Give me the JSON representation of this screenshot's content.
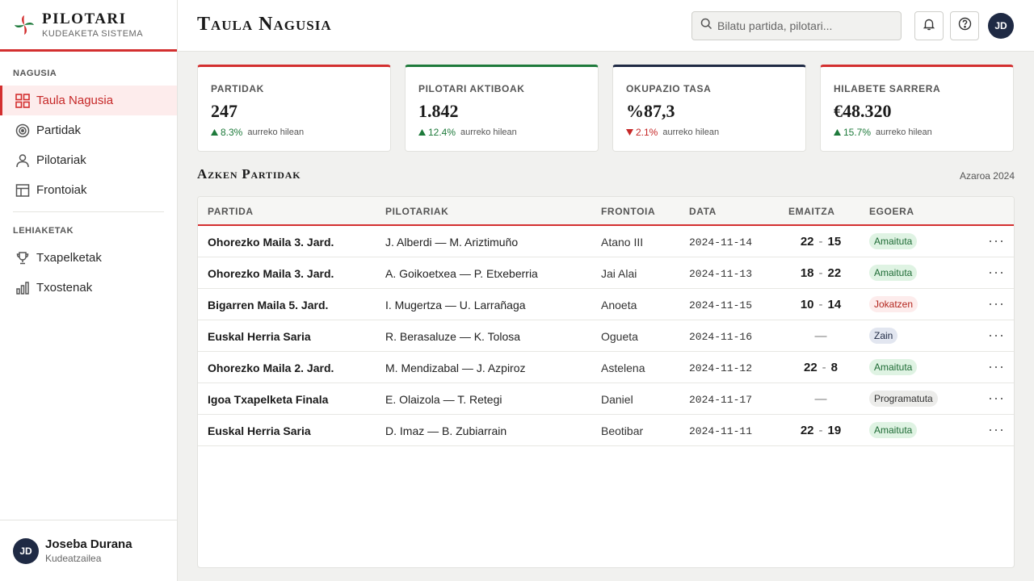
{
  "brand": {
    "name": "PILOTARI",
    "subtitle": "KUDEAKETA SISTEMA"
  },
  "sidebar": {
    "sections": [
      {
        "title": "NAGUSIA",
        "items": [
          {
            "label": "Taula Nagusia",
            "icon": "dashboard-grid-icon",
            "active": true
          },
          {
            "label": "Partidak",
            "icon": "target-icon"
          },
          {
            "label": "Pilotariak",
            "icon": "user-icon"
          },
          {
            "label": "Frontoiak",
            "icon": "layout-icon"
          }
        ]
      },
      {
        "title": "LEHIAKETAK",
        "items": [
          {
            "label": "Txapelketak",
            "icon": "trophy-icon"
          },
          {
            "label": "Txostenak",
            "icon": "bar-chart-icon"
          }
        ]
      }
    ],
    "user": {
      "initials": "JD",
      "name": "Joseba Durana",
      "role": "Kudeatzailea"
    }
  },
  "header": {
    "title": "Taula Nagusia",
    "search_placeholder": "Bilatu partida, pilotari...",
    "avatar_initials": "JD"
  },
  "stats": [
    {
      "label": "PARTIDAK",
      "value": "247",
      "delta": "8.3%",
      "trend": "up",
      "note": "aurreko hilean",
      "accent": "#d32f2f"
    },
    {
      "label": "PILOTARI AKTIBOAK",
      "value": "1.842",
      "delta": "12.4%",
      "trend": "up",
      "note": "aurreko hilean",
      "accent": "#1e7a3b"
    },
    {
      "label": "OKUPAZIO TASA",
      "value": "%87,3",
      "delta": "2.1%",
      "trend": "down",
      "note": "aurreko hilean",
      "accent": "#1f2a44"
    },
    {
      "label": "HILABETE SARRERA",
      "value": "€48.320",
      "delta": "15.7%",
      "trend": "up",
      "note": "aurreko hilean",
      "accent": "#d32f2f"
    }
  ],
  "recent": {
    "title": "Azken Partidak",
    "period": "Azaroa 2024",
    "columns": [
      "PARTIDA",
      "PILOTARIAK",
      "FRONTOIA",
      "DATA",
      "EMAITZA",
      "EGOERA"
    ],
    "rows": [
      {
        "match": "Ohorezko Maila 3. Jard.",
        "players": "J. Alberdi — M. Ariztimuño",
        "venue": "Atano III",
        "date": "2024-11-14",
        "score_a": "22",
        "score_b": "15",
        "status": "Amaituta",
        "status_type": "done"
      },
      {
        "match": "Ohorezko Maila 3. Jard.",
        "players": "A. Goikoetxea — P. Etxeberria",
        "venue": "Jai Alai",
        "date": "2024-11-13",
        "score_a": "18",
        "score_b": "22",
        "status": "Amaituta",
        "status_type": "done"
      },
      {
        "match": "Bigarren Maila 5. Jard.",
        "players": "I. Mugertza — U. Larrañaga",
        "venue": "Anoeta",
        "date": "2024-11-15",
        "score_a": "10",
        "score_b": "14",
        "status": "Jokatzen",
        "status_type": "live"
      },
      {
        "match": "Euskal Herria Saria",
        "players": "R. Berasaluze — K. Tolosa",
        "venue": "Ogueta",
        "date": "2024-11-16",
        "score_a": "",
        "score_b": "",
        "no_score": "—",
        "status": "Zain",
        "status_type": "wait"
      },
      {
        "match": "Ohorezko Maila 2. Jard.",
        "players": "M. Mendizabal — J. Azpiroz",
        "venue": "Astelena",
        "date": "2024-11-12",
        "score_a": "22",
        "score_b": "8",
        "status": "Amaituta",
        "status_type": "done"
      },
      {
        "match": "Igoa Txapelketa Finala",
        "players": "E. Olaizola — T. Retegi",
        "venue": "Daniel",
        "date": "2024-11-17",
        "score_a": "",
        "score_b": "",
        "no_score": "—",
        "status": "Programatuta",
        "status_type": "sched"
      },
      {
        "match": "Euskal Herria Saria",
        "players": "D. Imaz — B. Zubiarrain",
        "venue": "Beotibar",
        "date": "2024-11-11",
        "score_a": "22",
        "score_b": "19",
        "status": "Amaituta",
        "status_type": "done"
      }
    ]
  }
}
